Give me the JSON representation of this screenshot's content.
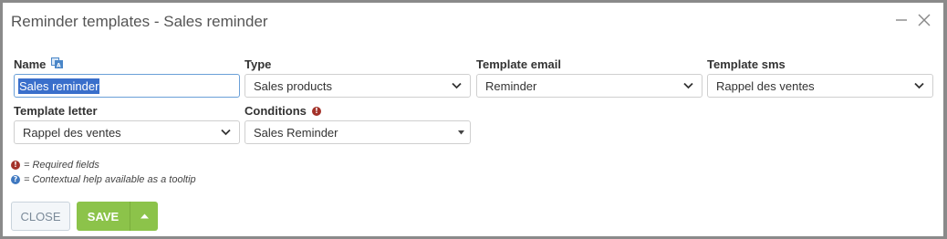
{
  "dialog": {
    "title": "Reminder templates - Sales reminder"
  },
  "fields": {
    "name": {
      "label": "Name",
      "value": "Sales reminder"
    },
    "type": {
      "label": "Type",
      "value": "Sales products"
    },
    "template_email": {
      "label": "Template email",
      "value": "Reminder"
    },
    "template_sms": {
      "label": "Template sms",
      "value": "Rappel des ventes"
    },
    "template_letter": {
      "label": "Template letter",
      "value": "Rappel des ventes"
    },
    "conditions": {
      "label": "Conditions",
      "value": "Sales Reminder"
    }
  },
  "legend": {
    "required": "= Required fields",
    "help": "= Contextual help available as a tooltip"
  },
  "buttons": {
    "close": "CLOSE",
    "save": "SAVE"
  },
  "colors": {
    "save_green": "#8cc34a",
    "required_red": "#a3322a",
    "help_blue": "#3f78c0",
    "selection_blue": "#3a6fcb"
  },
  "icons": [
    "minimize-icon",
    "close-icon",
    "translate-icon",
    "required-icon",
    "help-icon",
    "chevron-down-icon",
    "caret-up-icon"
  ]
}
